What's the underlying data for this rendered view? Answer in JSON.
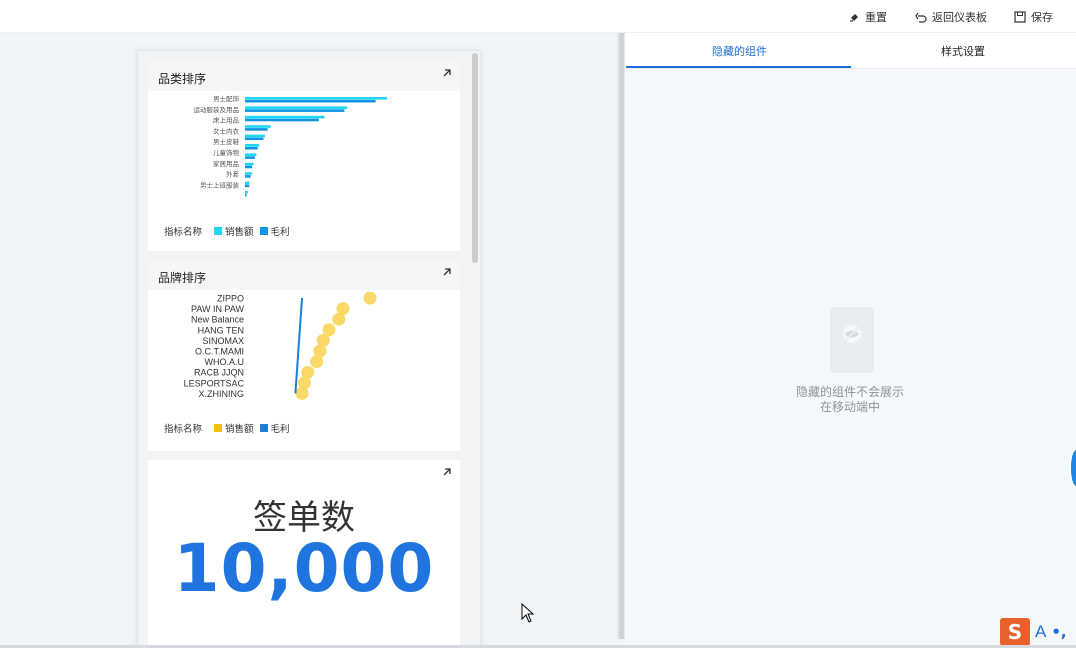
{
  "toolbar": {
    "reset_label": "重置",
    "back_label": "返回仪表板",
    "save_label": "保存"
  },
  "category_card": {
    "title": "品类排序",
    "legend_title": "指标名称",
    "legend": [
      "销售额",
      "毛利"
    ],
    "chart_data": {
      "type": "bar",
      "orientation": "horizontal",
      "categories": [
        "男士配饰",
        "运动服装及用品",
        "床上用品",
        "女士内衣",
        "男士皮鞋",
        "儿童饰物",
        "家居用品",
        "外套",
        "男士上班服装"
      ],
      "tick_labels": [
        "男士配饰",
        "运动服装及用品",
        "床上用品",
        "女士内衣",
        "男士皮鞋",
        "儿童饰物",
        "家居用品",
        "外套",
        "男士上班服装"
      ],
      "series": [
        {
          "name": "销售额",
          "color": "#1ed6f0",
          "values": [
            100,
            72,
            56,
            18,
            14,
            10,
            8,
            6,
            5,
            3,
            2
          ]
        },
        {
          "name": "毛利",
          "color": "#0f94e8",
          "values": [
            92,
            70,
            52,
            16,
            13,
            9,
            7,
            5,
            4,
            3,
            1
          ]
        }
      ]
    }
  },
  "brand_card": {
    "title": "品牌排序",
    "legend_title": "指标名称",
    "legend": [
      "销售额",
      "毛利"
    ],
    "chart_data": {
      "type": "scatter",
      "categories": [
        "ZIPPO",
        "PAW IN PAW",
        "New Balance",
        "HANG TEN",
        "SINOMAX",
        "O.C.T.MAMI",
        "WHO.A.U",
        "RACB JJQN",
        "LESPORTSAC",
        "X.ZHINING"
      ],
      "series": [
        {
          "name": "销售额",
          "color": "#f8d65a",
          "values": [
            100,
            67,
            62,
            50,
            43,
            39,
            35,
            24,
            20,
            17
          ]
        },
        {
          "name": "毛利",
          "color": "#1c7ed6",
          "values": [
            19,
            18,
            17,
            16,
            15,
            14,
            13,
            12,
            11,
            10
          ]
        }
      ]
    }
  },
  "kpi_card": {
    "title": "签单数",
    "value": "10,000"
  },
  "right_panel": {
    "tabs": [
      "隐藏的组件",
      "样式设置"
    ],
    "empty_line1": "隐藏的组件不会展示",
    "empty_line2": "在移动端中"
  },
  "ime": {
    "logo": "S",
    "mode": "A",
    "punct": "•,"
  },
  "colors": {
    "accent": "#1c6fdc",
    "kpi": "#1f74e0",
    "bar_sales": "#1ed6f0",
    "bar_profit": "#0f94e8",
    "dot_sales": "#f8d65a",
    "line_profit": "#1c7ed6"
  }
}
